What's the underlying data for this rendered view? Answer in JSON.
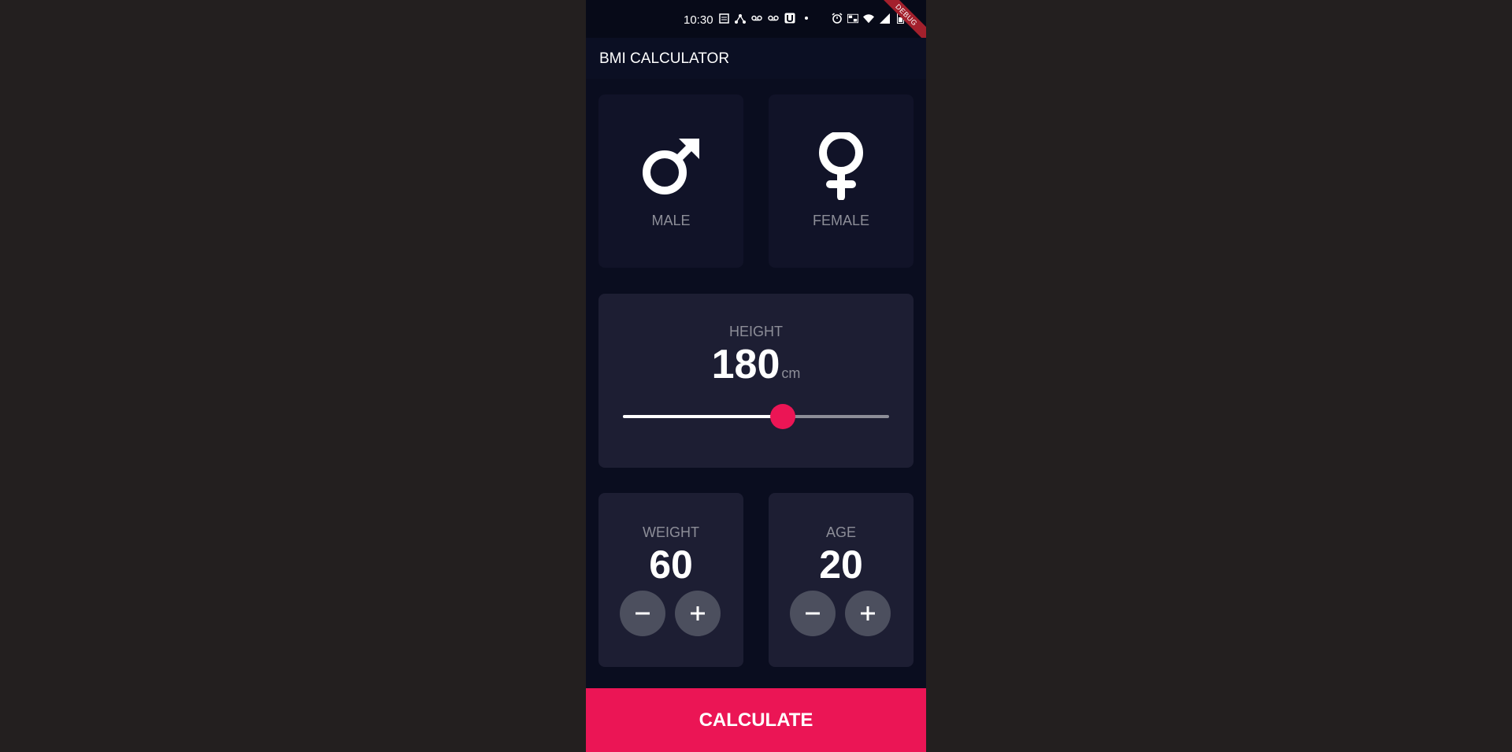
{
  "status_bar": {
    "time": "10:30",
    "icons": [
      "news-icon",
      "network-icon",
      "voicemail-icon",
      "voicemail-icon",
      "u-icon",
      "dot-icon"
    ],
    "right_icons": [
      "alarm-icon",
      "data-icon",
      "wifi-icon",
      "signal-icon",
      "battery-icon"
    ],
    "debug_label": "DEBUG"
  },
  "appbar": {
    "title": "BMI CALCULATOR"
  },
  "gender": {
    "male_label": "MALE",
    "female_label": "FEMALE",
    "selected": "none"
  },
  "height": {
    "label": "HEIGHT",
    "value": "180",
    "unit": "cm",
    "slider_fraction": 0.6
  },
  "weight": {
    "label": "WEIGHT",
    "value": "60"
  },
  "age": {
    "label": "AGE",
    "value": "20"
  },
  "calculate_label": "CALCULATE",
  "colors": {
    "accent": "#eb1555",
    "card_active": "#1d1e33",
    "card_inactive": "#111328",
    "label": "#8d8e98",
    "button": "#4c4f5e"
  }
}
